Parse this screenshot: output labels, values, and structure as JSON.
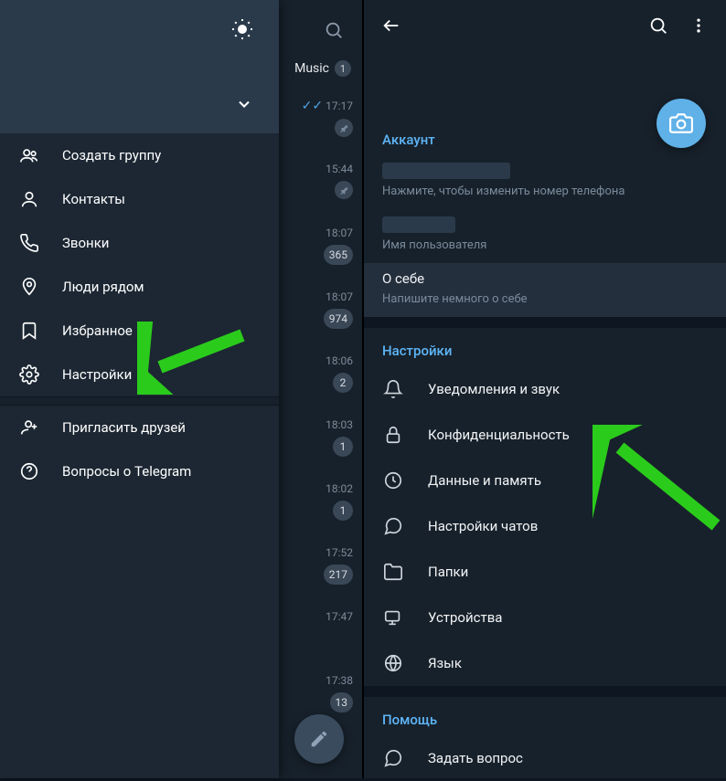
{
  "left": {
    "menu": [
      {
        "icon": "group",
        "label": "Создать группу"
      },
      {
        "icon": "contact",
        "label": "Контакты"
      },
      {
        "icon": "call",
        "label": "Звонки"
      },
      {
        "icon": "nearby",
        "label": "Люди рядом"
      },
      {
        "icon": "bookmark",
        "label": "Избранное"
      },
      {
        "icon": "settings",
        "label": "Настройки"
      }
    ],
    "menu2": [
      {
        "icon": "invite",
        "label": "Пригласить друзей"
      },
      {
        "icon": "help",
        "label": "Вопросы о Telegram"
      }
    ]
  },
  "chat_strip": {
    "folder_tab": "Music",
    "folder_badge": "1",
    "rows": [
      {
        "time": "17:17",
        "type": "checks"
      },
      {
        "time": "15:44",
        "type": "pin"
      },
      {
        "time": "18:07",
        "type": "badge",
        "badge": "365"
      },
      {
        "time": "18:07",
        "type": "badge",
        "badge": "974"
      },
      {
        "time": "18:06",
        "type": "badge",
        "badge": "2"
      },
      {
        "time": "18:03",
        "type": "badge",
        "badge": "1"
      },
      {
        "time": "18:02",
        "type": "badge",
        "badge": "1"
      },
      {
        "time": "17:52",
        "type": "badge",
        "badge": "217"
      },
      {
        "time": "17:47",
        "type": "none"
      },
      {
        "time": "17:38",
        "type": "badge",
        "badge": "13"
      }
    ]
  },
  "right": {
    "account_header": "Аккаунт",
    "phone_sub": "Нажмите, чтобы изменить номер телефона",
    "username_sub": "Имя пользователя",
    "about_title": "О себе",
    "about_sub": "Напишите немного о себе",
    "settings_header": "Настройки",
    "settings": [
      {
        "icon": "bell",
        "label": "Уведомления и звук"
      },
      {
        "icon": "lock",
        "label": "Конфиденциальность"
      },
      {
        "icon": "data",
        "label": "Данные и память"
      },
      {
        "icon": "chat",
        "label": "Настройки чатов"
      },
      {
        "icon": "folder",
        "label": "Папки"
      },
      {
        "icon": "devices",
        "label": "Устройства"
      },
      {
        "icon": "globe",
        "label": "Язык"
      }
    ],
    "help_header": "Помощь",
    "help_item": "Задать вопрос"
  }
}
